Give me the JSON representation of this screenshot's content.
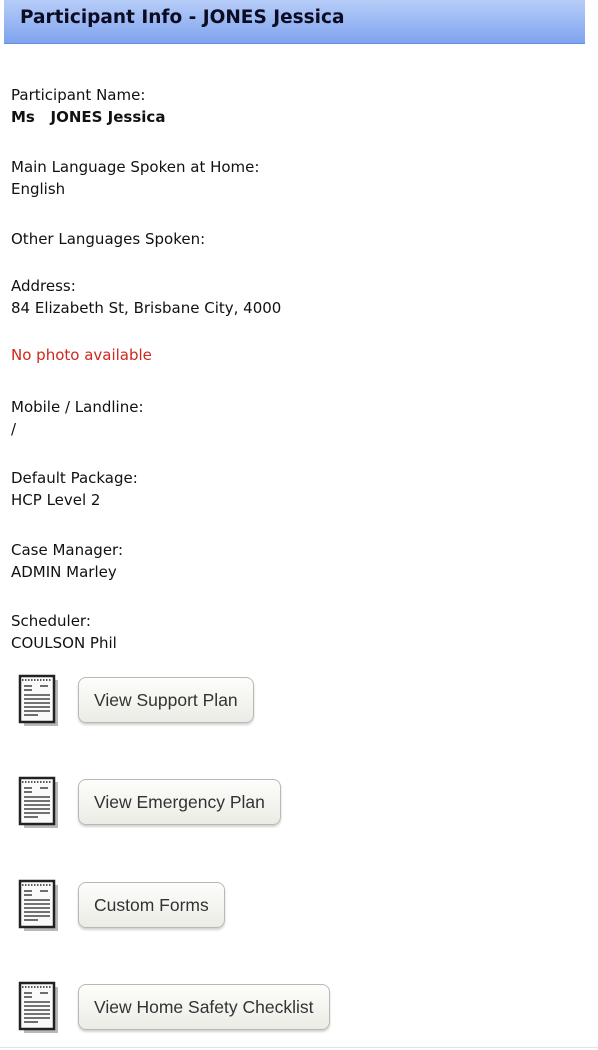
{
  "header": {
    "title": "Participant Info - JONES Jessica"
  },
  "fields": {
    "participant_name": {
      "label": "Participant Name:",
      "value": "Ms   JONES Jessica"
    },
    "main_language": {
      "label": "Main Language Spoken at Home:",
      "value": "English"
    },
    "other_languages": {
      "label": "Other Languages Spoken:",
      "value": ""
    },
    "address": {
      "label": "Address:",
      "value": "84 Elizabeth St, Brisbane City, 4000"
    },
    "photo_status": "No photo available",
    "phone": {
      "label": "Mobile / Landline:",
      "value": "/"
    },
    "default_package": {
      "label": "Default Package:",
      "value": "HCP Level 2"
    },
    "case_manager": {
      "label": "Case Manager:",
      "value": "ADMIN Marley"
    },
    "scheduler": {
      "label": "Scheduler:",
      "value": "COULSON Phil"
    }
  },
  "actions": {
    "support_plan": "View Support Plan",
    "emergency_plan": "View Emergency Plan",
    "custom_forms": "Custom Forms",
    "home_safety": "View Home Safety Checklist"
  },
  "icons": {
    "document": "notepad-document-icon"
  },
  "colors": {
    "header_top": "#b7cdf8",
    "header_bottom": "#7fa3ee",
    "warning_text": "#d0261c"
  }
}
